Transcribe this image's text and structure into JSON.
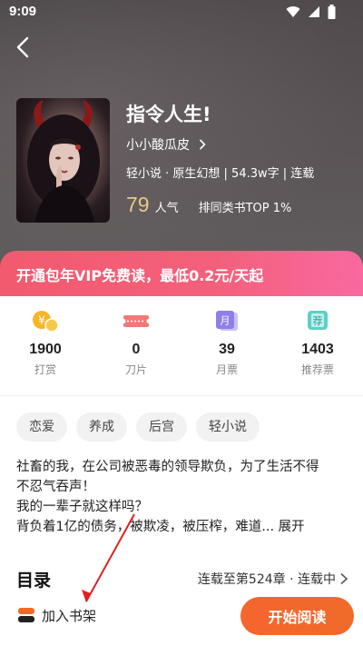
{
  "status_bar": {
    "time": "9:09"
  },
  "book": {
    "title": "指令人生!",
    "author": "小小酸瓜皮",
    "meta": "轻小说 · 原生幻想 | 54.3w字 | 连载",
    "popularity_value": "79",
    "popularity_label": "人气",
    "rank": "排同类书TOP 1%"
  },
  "vip_banner": {
    "text": "开通包年VIP免费读，最低0.2元/天起"
  },
  "stats": [
    {
      "value": "1900",
      "label": "打赏",
      "icon": "coin-icon"
    },
    {
      "value": "0",
      "label": "刀片",
      "icon": "blade-icon"
    },
    {
      "value": "39",
      "label": "月票",
      "icon": "monthly-ticket-icon"
    },
    {
      "value": "1403",
      "label": "推荐票",
      "icon": "recommend-ticket-icon"
    }
  ],
  "tags": [
    "恋爱",
    "养成",
    "后宫",
    "轻小说"
  ],
  "synopsis": {
    "line1": "社畜的我，在公司被恶毒的领导欺负，为了生活不得",
    "line2": "不忍气吞声！",
    "line3": "我的一辈子就这样吗？",
    "line4": "背负着1亿的债务，被欺凌，被压榨，难道... ",
    "expand": "展开"
  },
  "toc": {
    "title": "目录",
    "status": "连载至第524章 · 连载中"
  },
  "bottom_bar": {
    "bookshelf": "加入书架",
    "start_reading": "开始阅读"
  },
  "colors": {
    "accent_orange": "#f06a2a",
    "vip_pink": "#f4607c",
    "popularity_gold": "#e8c98a",
    "annotation_arrow": "#e02020"
  }
}
